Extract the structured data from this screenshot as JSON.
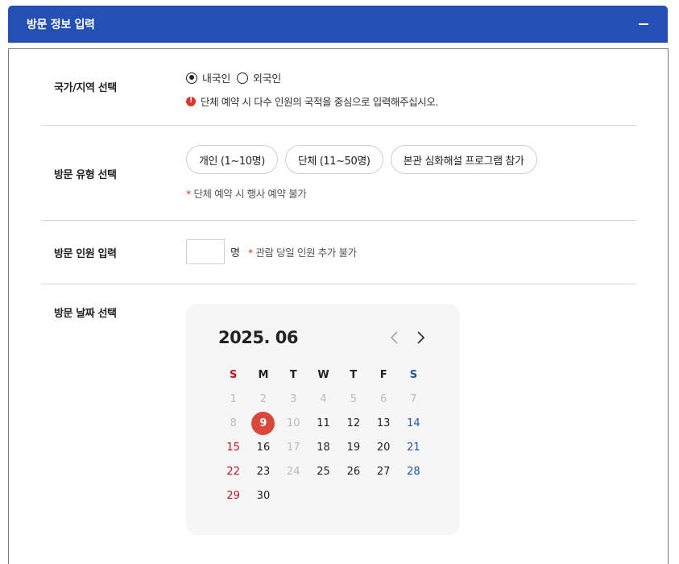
{
  "header": {
    "title": "방문 정보 입력",
    "collapse_icon": "minus-icon"
  },
  "region": {
    "label": "국가/지역 선택",
    "options": [
      {
        "label": "내국인",
        "checked": true
      },
      {
        "label": "외국인",
        "checked": false
      }
    ],
    "warning_icon": "!",
    "warning": "단체 예약 시 다수 인원의 국적을 중심으로 입력해주십시오."
  },
  "visit_type": {
    "label": "방문 유형 선택",
    "options": [
      "개인 (1~10명)",
      "단체 (11~50명)",
      "본관 심화해설 프로그램 참가"
    ],
    "note_star": "*",
    "note": "단체 예약 시 행사 예약 불가"
  },
  "count": {
    "label": "방문 인원 입력",
    "value": "",
    "unit": "명",
    "note_star": "*",
    "note": "관람 당일 인원 추가 불가"
  },
  "date": {
    "label": "방문 날짜 선택",
    "calendar": {
      "title": "2025. 06",
      "prev_icon": "chevron-left-icon",
      "next_icon": "chevron-right-icon",
      "weekdays": [
        "S",
        "M",
        "T",
        "W",
        "T",
        "F",
        "S"
      ],
      "selected": "9",
      "weeks": [
        [
          [
            "1",
            "disabled"
          ],
          [
            "2",
            "disabled"
          ],
          [
            "3",
            "disabled"
          ],
          [
            "4",
            "disabled"
          ],
          [
            "5",
            "disabled"
          ],
          [
            "6",
            "disabled"
          ],
          [
            "7",
            "disabled"
          ]
        ],
        [
          [
            "8",
            "disabled"
          ],
          [
            "9",
            "selected"
          ],
          [
            "10",
            "disabled"
          ],
          [
            "11",
            "normal"
          ],
          [
            "12",
            "normal"
          ],
          [
            "13",
            "normal"
          ],
          [
            "14",
            "sat"
          ]
        ],
        [
          [
            "15",
            "sun"
          ],
          [
            "16",
            "normal"
          ],
          [
            "17",
            "disabled"
          ],
          [
            "18",
            "normal"
          ],
          [
            "19",
            "normal"
          ],
          [
            "20",
            "normal"
          ],
          [
            "21",
            "sat"
          ]
        ],
        [
          [
            "22",
            "sun"
          ],
          [
            "23",
            "normal"
          ],
          [
            "24",
            "disabled"
          ],
          [
            "25",
            "normal"
          ],
          [
            "26",
            "normal"
          ],
          [
            "27",
            "normal"
          ],
          [
            "28",
            "sat"
          ]
        ],
        [
          [
            "29",
            "sun"
          ],
          [
            "30",
            "normal"
          ],
          [
            "",
            "empty"
          ],
          [
            "",
            "empty"
          ],
          [
            "",
            "empty"
          ],
          [
            "",
            "empty"
          ],
          [
            "",
            "empty"
          ]
        ]
      ]
    }
  },
  "colors": {
    "header": "#2450b5",
    "accent_red": "#d9372a",
    "sunday": "#c0141e",
    "saturday": "#2157a8",
    "selected": "#d9483a"
  }
}
